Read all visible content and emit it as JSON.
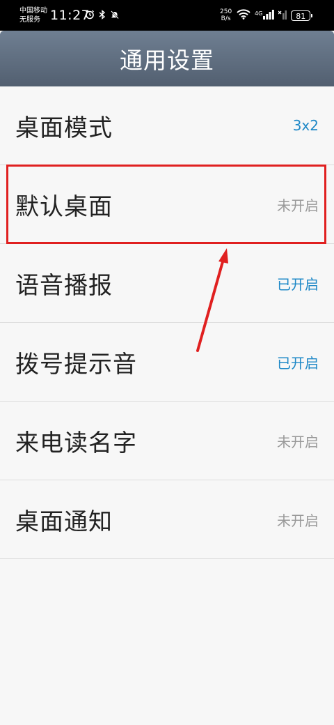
{
  "status_bar": {
    "carrier_line1": "中国移动",
    "carrier_line2": "无服务",
    "time": "11:27",
    "speed_value": "250",
    "speed_unit": "B/s",
    "network_type": "4G",
    "battery": "81"
  },
  "header": {
    "title": "通用设置"
  },
  "settings": [
    {
      "label": "桌面模式",
      "value": "3x2",
      "state": "on"
    },
    {
      "label": "默认桌面",
      "value": "未开启",
      "state": "off"
    },
    {
      "label": "语音播报",
      "value": "已开启",
      "state": "on"
    },
    {
      "label": "拨号提示音",
      "value": "已开启",
      "state": "on"
    },
    {
      "label": "来电读名字",
      "value": "未开启",
      "state": "off"
    },
    {
      "label": "桌面通知",
      "value": "未开启",
      "state": "off"
    }
  ],
  "colors": {
    "accent_on": "#1e88c7",
    "muted_off": "#999999",
    "annotation": "#e02020",
    "title_bar": "#5e6b7c"
  }
}
